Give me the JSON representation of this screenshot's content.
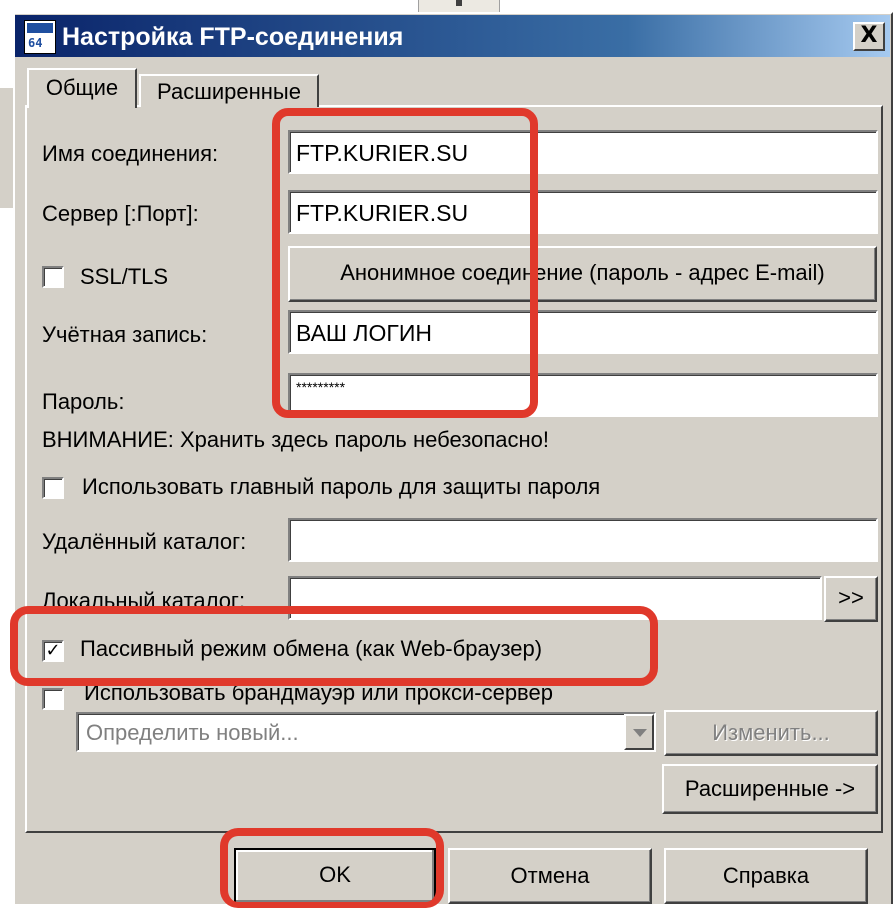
{
  "window": {
    "title": "Настройка FTP-соединения",
    "icon_text": "64",
    "close_label": "X"
  },
  "tabs": [
    {
      "label": "Общие",
      "active": true
    },
    {
      "label": "Расширенные",
      "active": false
    }
  ],
  "form": {
    "connection_name_label": "Имя соединения:",
    "connection_name_value": "FTP.KURIER.SU",
    "server_label": "Сервер [:Порт]:",
    "server_value": "FTP.KURIER.SU",
    "ssl_label": "SSL/TLS",
    "ssl_checked": false,
    "anonymous_button": "Анонимное соединение (пароль - адрес E-mail)",
    "account_label": "Учётная запись:",
    "account_value": "ВАШ ЛОГИН",
    "password_label": "Пароль:",
    "password_value": "*********",
    "warning_text": "ВНИМАНИЕ: Хранить здесь пароль небезопасно!",
    "master_password_label": "Использовать главный пароль для защиты пароля",
    "master_password_checked": false,
    "remote_dir_label": "Удалённый каталог:",
    "remote_dir_value": "",
    "local_dir_label": "Локальный каталог:",
    "local_dir_value": "",
    "browse_button": ">>",
    "passive_mode_label": "Пассивный режим обмена (как Web-браузер)",
    "passive_mode_checked": true,
    "proxy_label": "Использовать брандмауэр или прокси-сервер",
    "proxy_checked": false,
    "proxy_select_value": "Определить новый...",
    "change_button": "Изменить...",
    "advanced_button": "Расширенные ->"
  },
  "buttons": {
    "ok": "OK",
    "cancel": "Отмена",
    "help": "Справка"
  },
  "colors": {
    "dialog_bg": "#d4d0c8",
    "title_bar": "#0a246a",
    "highlight": "#e0392b"
  }
}
